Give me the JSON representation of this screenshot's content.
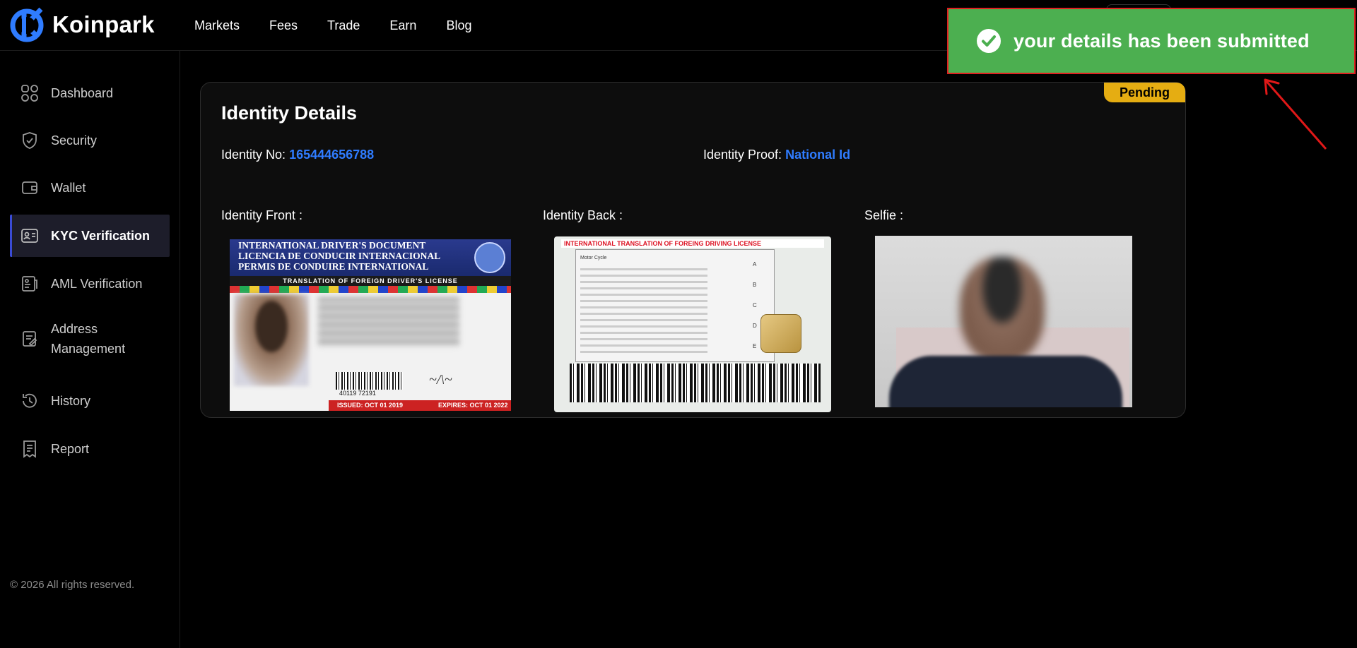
{
  "brand": {
    "name": "Koinpark",
    "accent": "#2f7cff"
  },
  "nav": {
    "links": [
      "Markets",
      "Fees",
      "Trade",
      "Earn",
      "Blog"
    ]
  },
  "sidebar": {
    "items": [
      {
        "label": "Dashboard",
        "icon": "dashboard-icon"
      },
      {
        "label": "Security",
        "icon": "shield-icon"
      },
      {
        "label": "Wallet",
        "icon": "wallet-icon"
      },
      {
        "label": "KYC Verification",
        "icon": "id-card-icon",
        "active": true
      },
      {
        "label": "AML Verification",
        "icon": "aml-icon"
      },
      {
        "label": "Address\nManagement",
        "icon": "address-book-icon"
      },
      {
        "label": "History",
        "icon": "history-icon"
      },
      {
        "label": "Report",
        "icon": "report-icon"
      }
    ],
    "copyright": "© 2026 All rights reserved."
  },
  "identity": {
    "title": "Identity Details",
    "status": "Pending",
    "status_color": "#e5ad12",
    "id_no_label": "Identity No:",
    "id_no_value": "165444656788",
    "proof_label": "Identity Proof:",
    "proof_value": "National Id",
    "front_label": "Identity Front :",
    "back_label": "Identity Back :",
    "selfie_label": "Selfie :",
    "front_card": {
      "line1": "INTERNATIONAL DRIVER'S DOCUMENT",
      "line2": "LICENCIA DE CONDUCIR INTERNACIONAL",
      "line3": "PERMIS DE CONDUIRE INTERNATIONAL",
      "band": "TRANSLATION OF FOREIGN DRIVER'S LICENSE",
      "barcode_no": "40119 72191",
      "issued": "ISSUED: OCT 01 2019",
      "expires": "EXPIRES: OCT 01 2022"
    },
    "back_card": {
      "title": "INTERNATIONAL TRANSLATION OF FOREING DRIVING LICENSE",
      "row_a": "Motor Cycle",
      "classes": [
        "A",
        "B",
        "C",
        "D",
        "E"
      ]
    }
  },
  "toast": {
    "message": "your details has been submitted",
    "color": "#4caf50"
  }
}
